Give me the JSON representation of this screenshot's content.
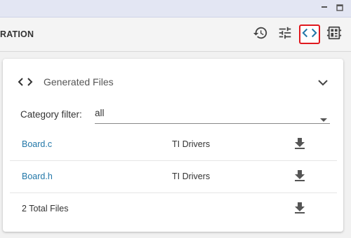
{
  "header": {
    "title": "RATION",
    "toolbar": [
      {
        "icon": "history-icon"
      },
      {
        "icon": "settings-sliders-icon"
      },
      {
        "icon": "code-icon",
        "selected": true
      },
      {
        "icon": "board-icon"
      }
    ]
  },
  "panel": {
    "title": "Generated Files",
    "filter": {
      "label": "Category filter:",
      "value": "all"
    },
    "files": [
      {
        "name": "Board.c",
        "category": "TI Drivers"
      },
      {
        "name": "Board.h",
        "category": "TI Drivers"
      }
    ],
    "total": "2 Total Files"
  },
  "colors": {
    "accent": "#2277a8",
    "highlight_border": "#e0191f",
    "header_bg": "#f4f4f4",
    "chrome_bg": "#e3e6f3"
  }
}
